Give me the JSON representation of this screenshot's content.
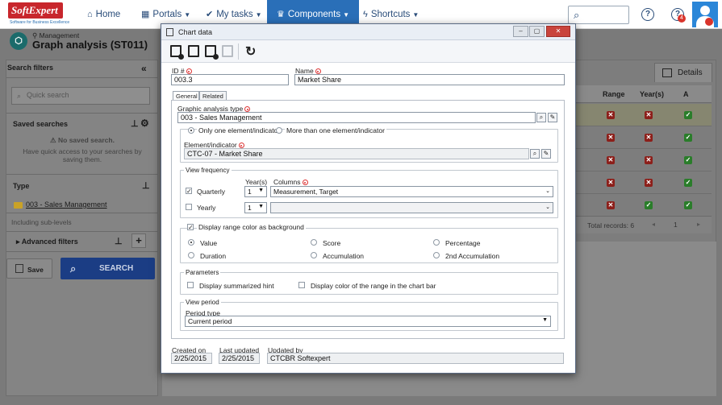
{
  "brand": {
    "logo_text": "SoftExpert",
    "tagline": "Software for Business Excellence"
  },
  "nav": {
    "items": [
      {
        "label": "Home",
        "icon": "home-icon"
      },
      {
        "label": "Portals",
        "icon": "grid-icon"
      },
      {
        "label": "My tasks",
        "icon": "check-icon"
      },
      {
        "label": "Components",
        "icon": "trophy-icon"
      },
      {
        "label": "Shortcuts",
        "icon": "bolt-icon"
      }
    ],
    "notification_count": "4"
  },
  "header": {
    "breadcrumb": "Management",
    "title": "Graph analysis (ST011)"
  },
  "left_panel": {
    "title": "Search filters",
    "quick_search_placeholder": "Quick search",
    "saved_searches_label": "Saved searches",
    "no_saved_title": "No saved search.",
    "no_saved_desc": "Have quick access to your searches by saving them.",
    "type_label": "Type",
    "type_value": "003 - Sales Management",
    "including_sublevels": "Including sub-levels",
    "advanced_filters": "Advanced filters",
    "save_label": "Save",
    "search_label": "SEARCH"
  },
  "right_panel": {
    "details_tab": "Details",
    "columns": [
      "Range",
      "Year(s)",
      "A"
    ],
    "rows": [
      [
        "x",
        "x",
        "v"
      ],
      [
        "x",
        "x",
        "v"
      ],
      [
        "x",
        "x",
        "v"
      ],
      [
        "x",
        "x",
        "v"
      ],
      [
        "x",
        "v",
        "v"
      ]
    ],
    "total_records": "Total records: 6",
    "page_number": "1"
  },
  "dialog": {
    "title": "Chart data",
    "id_label": "ID #",
    "id_value": "003.3",
    "name_label": "Name",
    "name_value": "Market Share",
    "tabs": [
      "General",
      "Related"
    ],
    "graphic_type_label": "Graphic analysis type",
    "graphic_type_value": "003 - Sales Management",
    "radio_one": "Only one element/indicator",
    "radio_many": "More than one element/indicator",
    "element_label": "Element/indicator",
    "element_value": "CTC-07 - Market Share",
    "view_frequency_label": "View frequency",
    "years_label": "Year(s)",
    "columns_label": "Columns",
    "quarterly_label": "Quarterly",
    "quarterly_years": "1",
    "quarterly_columns": "Measurement, Target",
    "yearly_label": "Yearly",
    "yearly_years": "1",
    "display_range_label": "Display range color as background",
    "opt_value": "Value",
    "opt_score": "Score",
    "opt_percentage": "Percentage",
    "opt_duration": "Duration",
    "opt_accumulation": "Accumulation",
    "opt_2nd_accumulation": "2nd Accumulation",
    "parameters_label": "Parameters",
    "summarized_hint_label": "Display summarized hint",
    "range_color_bar_label": "Display color of the range in the chart bar",
    "view_period_label": "View period",
    "period_type_label": "Period type",
    "period_type_value": "Current period",
    "created_on_label": "Created on",
    "created_on_value": "2/25/2015",
    "last_updated_label": "Last updated",
    "last_updated_value": "2/25/2015",
    "updated_by_label": "Updated by",
    "updated_by_value": "CTCBR Softexpert"
  }
}
